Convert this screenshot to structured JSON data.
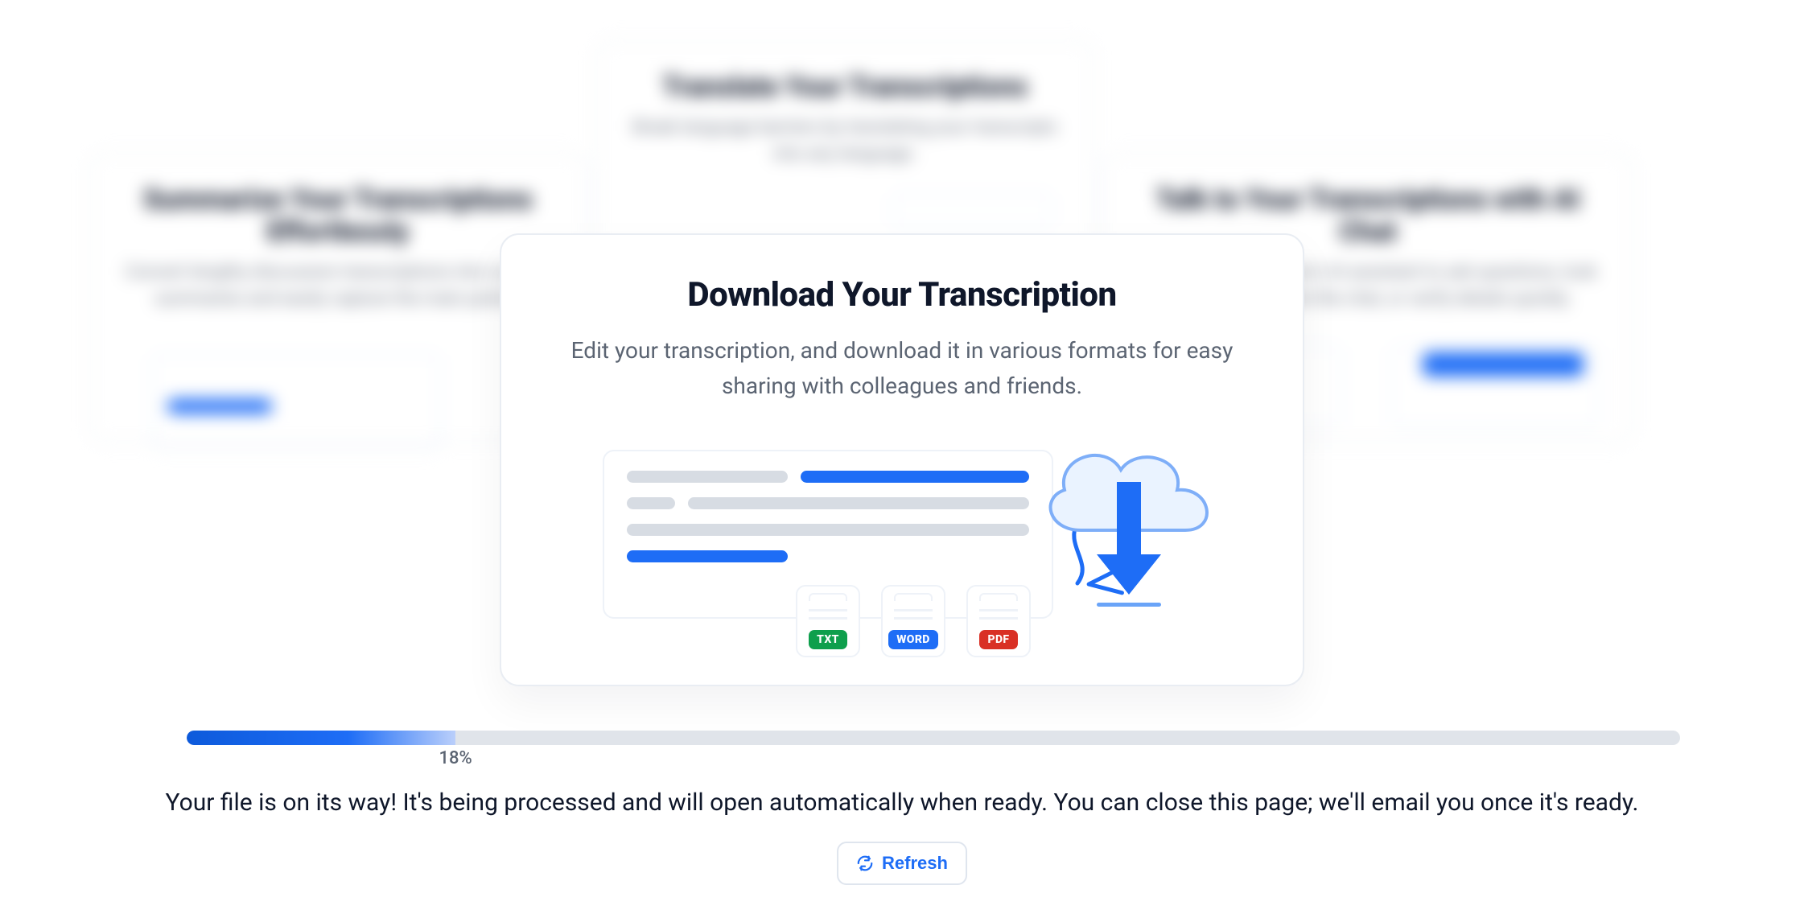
{
  "background_cards": {
    "left": {
      "title": "Summarize Your Transcriptions Effortlessly",
      "sub": "Convert lengthy discussion transcriptions into concise summaries and easily capture the main points."
    },
    "top": {
      "title": "Translate Your Transcriptions",
      "sub": "Break language barriers by translating your transcripts into any language."
    },
    "right": {
      "title": "Talk to Your Transcriptions with AI Chat",
      "sub": "Chat with Transkriptor's AI assistant to ask questions, look for specifics within the chat, or verify details quickly."
    }
  },
  "focus": {
    "title": "Download Your Transcription",
    "sub": "Edit your transcription, and download it in various formats for easy sharing with colleagues and friends.",
    "formats": {
      "txt": "TXT",
      "word": "WORD",
      "pdf": "PDF"
    }
  },
  "progress": {
    "percent": 18,
    "label": "18%"
  },
  "status_text": "Your file is on its way! It's being processed and will open automatically when ready. You can close this page; we'll email you once it's ready.",
  "refresh_label": "Refresh"
}
